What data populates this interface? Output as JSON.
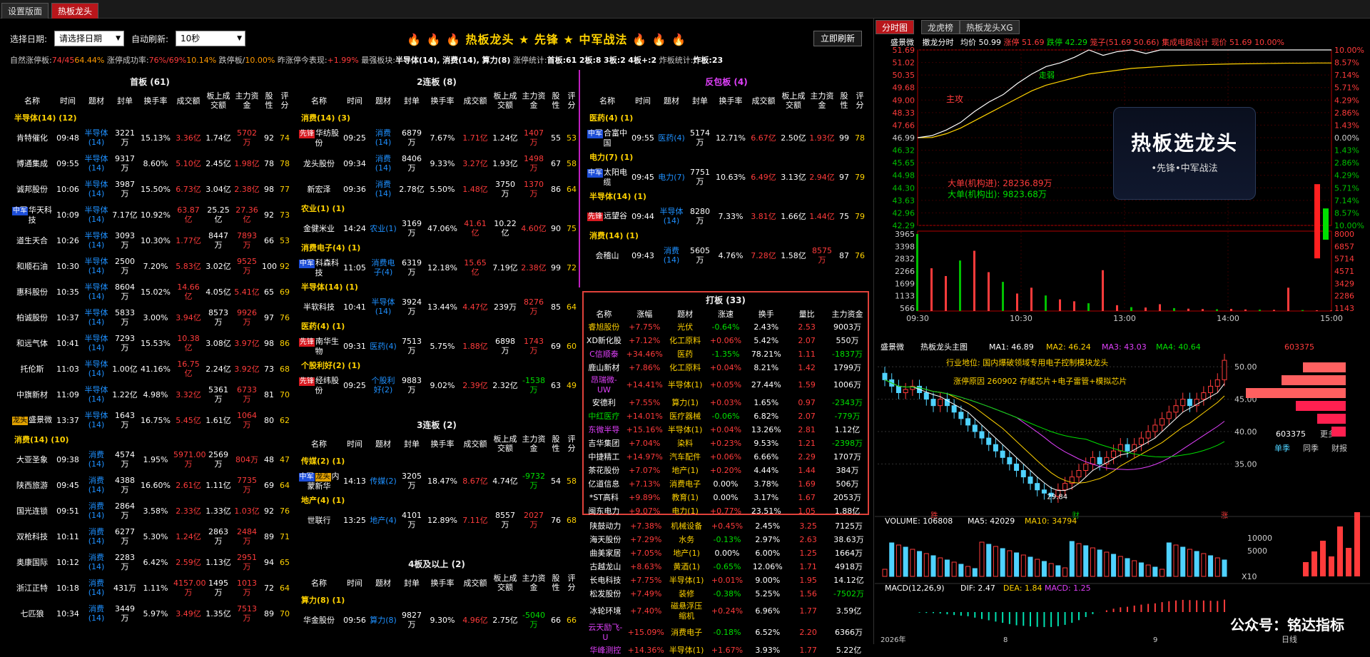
{
  "tabs": [
    "设置版面",
    "热板龙头"
  ],
  "toolbar": {
    "date_label": "选择日期:",
    "date_value": "请选择日期",
    "auto_label": "自动刷新:",
    "auto_value": "10秒",
    "title": "🔥 🔥 🔥 热板龙头 ★ 先锋 ★ 中军战法 🔥 🔥 🔥",
    "refresh": "立即刷新"
  },
  "summary": {
    "p1": "自然涨停板:",
    "v1": "74/45",
    "v1b": "64.44%",
    "p2": "涨停成功率:",
    "v2": "76%/69%",
    "v2b": "10.14%",
    "p3": "跌停板/",
    "v3": "10.00%",
    "p4": "昨涨停今表现:",
    "v4": "+1.99%",
    "p5": "最强板块:",
    "v5": "半导体(14), 消费(14), 算力(8)",
    "p6": "涨停统计:",
    "v6": "首板:61",
    "v7": "2板:8",
    "v8": "3板:2",
    "v9": "4板+:2",
    "p10": "炸板统计:",
    "v10": "炸板:23"
  },
  "col_headers": [
    "名称",
    "时间",
    "题材",
    "封单",
    "换手率",
    "成交额",
    "板上成交额",
    "主力资金",
    "股性",
    "评分"
  ],
  "p1": {
    "title": "首板 (61)",
    "groups": [
      {
        "name": "半导体(14) (12)",
        "rows": [
          [
            "",
            "肯特催化",
            "09:48",
            "半导体(14)",
            "3221万",
            "15.13%",
            "3.36亿",
            "1.74亿",
            "5702万",
            "92",
            "74"
          ],
          [
            "",
            "博通集成",
            "09:55",
            "半导体(14)",
            "9317万",
            "8.60%",
            "5.10亿",
            "2.45亿",
            "1.98亿",
            "78",
            "78"
          ],
          [
            "",
            "诚邦股份",
            "10:06",
            "半导体(14)",
            "3987万",
            "15.50%",
            "6.73亿",
            "3.04亿",
            "2.38亿",
            "98",
            "77"
          ],
          [
            "中军",
            "华天科技",
            "10:09",
            "半导体(14)",
            "7.17亿",
            "10.92%",
            "63.87亿",
            "25.25亿",
            "27.36亿",
            "92",
            "73"
          ],
          [
            "",
            "道生天合",
            "10:26",
            "半导体(14)",
            "3093万",
            "10.30%",
            "1.77亿",
            "8447万",
            "7893万",
            "66",
            "53"
          ],
          [
            "",
            "和顺石油",
            "10:30",
            "半导体(14)",
            "2500万",
            "7.20%",
            "5.83亿",
            "3.02亿",
            "9525万",
            "100",
            "92"
          ],
          [
            "",
            "惠科股份",
            "10:35",
            "半导体(14)",
            "8604万",
            "15.02%",
            "14.66亿",
            "4.05亿",
            "5.41亿",
            "65",
            "69"
          ],
          [
            "",
            "柏诚股份",
            "10:37",
            "半导体(14)",
            "5833万",
            "3.00%",
            "3.94亿",
            "8573万",
            "9926万",
            "97",
            "76"
          ],
          [
            "",
            "和远气体",
            "10:41",
            "半导体(14)",
            "7293万",
            "15.53%",
            "10.38亿",
            "3.08亿",
            "3.97亿",
            "98",
            "86"
          ],
          [
            "",
            "托伦斯",
            "11:03",
            "半导体(14)",
            "1.00亿",
            "41.16%",
            "16.75亿",
            "2.24亿",
            "3.92亿",
            "73",
            "68"
          ],
          [
            "",
            "中旗新材",
            "11:09",
            "半导体(14)",
            "1.22亿",
            "4.98%",
            "3.32亿",
            "5361万",
            "6733万",
            "81",
            "70"
          ],
          [
            "龙头",
            "盛景微",
            "13:37",
            "半导体(14)",
            "1643万",
            "16.75%",
            "5.45亿",
            "1.61亿",
            "1064万",
            "80",
            "62"
          ]
        ]
      },
      {
        "name": "消费(14) (10)",
        "rows": [
          [
            "",
            "大亚圣象",
            "09:38",
            "消费(14)",
            "4574万",
            "1.95%",
            "5971.00万",
            "2569万",
            "804万",
            "48",
            "47"
          ],
          [
            "",
            "陕西旅游",
            "09:45",
            "消费(14)",
            "4388万",
            "16.60%",
            "2.61亿",
            "1.11亿",
            "7735万",
            "69",
            "64"
          ],
          [
            "",
            "国光连锁",
            "09:51",
            "消费(14)",
            "2864万",
            "3.58%",
            "2.33亿",
            "1.33亿",
            "1.03亿",
            "92",
            "76"
          ],
          [
            "",
            "双枪科技",
            "10:11",
            "消费(14)",
            "6277万",
            "5.30%",
            "1.24亿",
            "2863万",
            "2484万",
            "89",
            "71"
          ],
          [
            "",
            "奥康国际",
            "10:12",
            "消费(14)",
            "2283万",
            "6.42%",
            "2.59亿",
            "1.13亿",
            "2951万",
            "94",
            "65"
          ],
          [
            "",
            "浙江正特",
            "10:18",
            "消费(14)",
            "431万",
            "1.11%",
            "4157.00万",
            "1495万",
            "1013万",
            "72",
            "64"
          ],
          [
            "",
            "七匹狼",
            "10:34",
            "消费(14)",
            "3449万",
            "5.97%",
            "3.49亿",
            "1.35亿",
            "7513万",
            "89",
            "70"
          ]
        ]
      }
    ]
  },
  "p2": {
    "title": "2连板 (8)",
    "groups": [
      {
        "name": "消费(14) (3)",
        "rows": [
          [
            "先锋",
            "华纺股份",
            "09:25",
            "消费(14)",
            "6879万",
            "7.67%",
            "1.71亿",
            "1.24亿",
            "1407万",
            "55",
            "53"
          ],
          [
            "",
            "龙头股份",
            "09:34",
            "消费(14)",
            "8406万",
            "9.33%",
            "3.27亿",
            "1.93亿",
            "1498万",
            "67",
            "58"
          ],
          [
            "",
            "新宏泽",
            "09:36",
            "消费(14)",
            "2.78亿",
            "5.50%",
            "1.48亿",
            "3750万",
            "1370万",
            "86",
            "64"
          ]
        ]
      },
      {
        "name": "农业(1) (1)",
        "rows": [
          [
            "",
            "金健米业",
            "14:24",
            "农业(1)",
            "3169万",
            "47.06%",
            "41.61亿",
            "10.22亿",
            "4.60亿",
            "90",
            "75"
          ]
        ]
      },
      {
        "name": "消费电子(4) (1)",
        "rows": [
          [
            "中军",
            "科森科技",
            "11:05",
            "消费电子(4)",
            "6319万",
            "12.18%",
            "15.65亿",
            "7.19亿",
            "2.38亿",
            "99",
            "72"
          ]
        ]
      },
      {
        "name": "半导体(14) (1)",
        "rows": [
          [
            "",
            "半软科技",
            "10:41",
            "半导体(14)",
            "3924万",
            "13.44%",
            "4.47亿",
            "239万",
            "8276万",
            "85",
            "64"
          ]
        ]
      },
      {
        "name": "医药(4) (1)",
        "rows": [
          [
            "先锋",
            "南华生物",
            "09:31",
            "医药(4)",
            "7513万",
            "5.75%",
            "1.88亿",
            "6898万",
            "1743万",
            "69",
            "60"
          ]
        ]
      },
      {
        "name": "个股利好(2) (1)",
        "rows": [
          [
            "先锋",
            "经纬股份",
            "09:25",
            "个股利好(2)",
            "9883万",
            "9.02%",
            "2.39亿",
            "2.32亿",
            "-1538万",
            "63",
            "49"
          ]
        ]
      }
    ]
  },
  "p3": {
    "title": "反包板 (4)",
    "groups": [
      {
        "name": "医药(4) (1)",
        "rows": [
          [
            "中军",
            "合富中国",
            "09:55",
            "医药(4)",
            "5174万",
            "12.71%",
            "6.67亿",
            "2.50亿",
            "1.93亿",
            "99",
            "78"
          ]
        ]
      },
      {
        "name": "电力(7) (1)",
        "rows": [
          [
            "中军",
            "太阳电缆",
            "09:45",
            "电力(7)",
            "7751万",
            "10.63%",
            "6.49亿",
            "3.13亿",
            "2.94亿",
            "97",
            "79"
          ]
        ]
      },
      {
        "name": "半导体(14) (1)",
        "rows": [
          [
            "先锋",
            "远望谷",
            "09:44",
            "半导体(14)",
            "8280万",
            "7.33%",
            "3.81亿",
            "1.66亿",
            "1.44亿",
            "75",
            "79"
          ]
        ]
      },
      {
        "name": "消费(14) (1)",
        "rows": [
          [
            "",
            "会稽山",
            "09:43",
            "消费(14)",
            "5605万",
            "4.76%",
            "7.28亿",
            "1.58亿",
            "8575万",
            "87",
            "76"
          ]
        ]
      }
    ]
  },
  "p4": {
    "title": "3连板 (2)",
    "groups": [
      {
        "name": "传媒(2) (1)",
        "rows": [
          [
            "中军 龙头",
            "内蒙新华",
            "14:13",
            "传媒(2)",
            "3205万",
            "18.47%",
            "8.67亿",
            "4.74亿",
            "-9732万",
            "54",
            "58"
          ]
        ]
      },
      {
        "name": "地产(4) (1)",
        "rows": [
          [
            "",
            "世联行",
            "13:25",
            "地产(4)",
            "4101万",
            "12.89%",
            "7.11亿",
            "8557万",
            "2027万",
            "76",
            "68"
          ]
        ]
      }
    ]
  },
  "p5": {
    "title": "4板及以上 (2)",
    "groups": [
      {
        "name": "算力(8) (1)",
        "rows": [
          [
            "",
            "华金股份",
            "09:56",
            "算力(8)",
            "9827万",
            "9.30%",
            "4.96亿",
            "2.75亿",
            "-5040万",
            "66",
            "66"
          ]
        ]
      }
    ]
  },
  "dab": {
    "title": "打板 (33)",
    "headers": [
      "名称",
      "涨幅",
      "题材",
      "涨速",
      "换手",
      "量比",
      "主力资金"
    ],
    "rows": [
      [
        "睿旭股份",
        "+7.75%",
        "光伏",
        "-0.64%",
        "2.43%",
        "2.53",
        "9003万"
      ],
      [
        "XD新化股",
        "+7.12%",
        "化工原料",
        "+0.06%",
        "5.42%",
        "2.07",
        "550万"
      ],
      [
        "C信顺泰",
        "+34.46%",
        "医药",
        "-1.35%",
        "78.21%",
        "1.11",
        "-1837万"
      ],
      [
        "鹿山新材",
        "+7.86%",
        "化工原料",
        "+0.04%",
        "8.21%",
        "1.42",
        "1799万"
      ],
      [
        "昂瑞微-UW",
        "+14.41%",
        "半导体(1)",
        "+0.05%",
        "27.44%",
        "1.59",
        "1006万"
      ],
      [
        "安德利",
        "+7.55%",
        "算力(1)",
        "+0.03%",
        "1.65%",
        "0.97",
        "-2343万"
      ],
      [
        "中红医疗",
        "+14.01%",
        "医疗器械",
        "-0.06%",
        "6.82%",
        "2.07",
        "-779万"
      ],
      [
        "东微半导",
        "+15.16%",
        "半导体(1)",
        "+0.04%",
        "13.26%",
        "2.81",
        "1.12亿"
      ],
      [
        "吉华集团",
        "+7.04%",
        "染料",
        "+0.23%",
        "9.53%",
        "1.21",
        "-2398万"
      ],
      [
        "中捷精工",
        "+14.97%",
        "汽车配件",
        "+0.06%",
        "6.66%",
        "2.29",
        "1707万"
      ],
      [
        "茶花股份",
        "+7.07%",
        "地产(1)",
        "+0.20%",
        "4.44%",
        "1.44",
        "384万"
      ],
      [
        "亿道信息",
        "+7.13%",
        "消费电子",
        "0.00%",
        "3.78%",
        "1.69",
        "506万"
      ],
      [
        "*ST高科",
        "+9.89%",
        "教育(1)",
        "0.00%",
        "3.17%",
        "1.67",
        "2053万"
      ],
      [
        "闽东电力",
        "+9.07%",
        "电力(1)",
        "+0.77%",
        "23.51%",
        "1.05",
        "1.88亿"
      ],
      [
        "陕鼓动力",
        "+7.38%",
        "机械设备",
        "+0.45%",
        "2.45%",
        "3.25",
        "7125万"
      ],
      [
        "海天股份",
        "+7.29%",
        "水务",
        "-0.13%",
        "2.97%",
        "2.63",
        "38.63万"
      ],
      [
        "曲美家居",
        "+7.05%",
        "地产(1)",
        "0.00%",
        "6.00%",
        "1.25",
        "1664万"
      ],
      [
        "古越龙山",
        "+8.63%",
        "黄酒(1)",
        "-0.65%",
        "12.06%",
        "1.71",
        "4918万"
      ],
      [
        "长电科技",
        "+7.75%",
        "半导体(1)",
        "+0.01%",
        "9.00%",
        "1.95",
        "14.12亿"
      ],
      [
        "松发股份",
        "+7.49%",
        "装修",
        "-0.38%",
        "5.25%",
        "1.56",
        "-7502万"
      ],
      [
        "冰轮环境",
        "+7.40%",
        "磁悬浮压缩机",
        "+0.24%",
        "6.96%",
        "1.77",
        "3.59亿"
      ],
      [
        "云天励飞-U",
        "+15.09%",
        "消费电子",
        "-0.18%",
        "6.52%",
        "2.20",
        "6366万"
      ],
      [
        "华峰测控",
        "+14.36%",
        "半导体(1)",
        "+1.67%",
        "3.93%",
        "1.77",
        "5.22亿"
      ]
    ]
  },
  "right": {
    "tabs": [
      "分时图",
      "龙虎榜",
      "热板龙头XG"
    ],
    "intraday": {
      "name": "盛景微",
      "mode": "撤龙分时",
      "avg": "均价 50.99",
      "zt": "涨停 51.69",
      "dt": "跌停 42.29",
      "bid": "笼子(51.69 50.66)",
      "sector": "集成电路设计",
      "now": "现价 51.69",
      "chg": "10.00%",
      "yl": [
        "51.69",
        "51.02",
        "50.35",
        "49.68",
        "49.00",
        "48.33",
        "47.66",
        "46.99",
        "46.32",
        "45.65",
        "44.98",
        "44.30",
        "43.63",
        "42.96",
        "42.29"
      ],
      "yr": [
        "10.00%",
        "8.57%",
        "7.14%",
        "5.71%",
        "4.29%",
        "2.86%",
        "1.43%",
        "0.00%",
        "1.43%",
        "2.86%",
        "4.29%",
        "5.71%",
        "7.14%",
        "8.57%",
        "10.00%"
      ],
      "vl": [
        "3965",
        "3398",
        "2832",
        "2266",
        "1699",
        "1133",
        "566"
      ],
      "vr": [
        "8000",
        "6857",
        "5714",
        "4571",
        "3429",
        "2286",
        "1143"
      ],
      "xt": [
        "09:30",
        "10:30",
        "13:00",
        "14:00",
        "15:00"
      ],
      "attack": "主攻",
      "trend": "走弱",
      "big_in": "大单(机构进): 28236.89万",
      "big_out": "大单(机构出): 9823.68万",
      "price": [
        46.99,
        47.1,
        47.4,
        47.8,
        48.4,
        48.9,
        49.3,
        49.9,
        50.4,
        50.8,
        51.0,
        51.3,
        51.69,
        51.4,
        51.6,
        51.69,
        51.5,
        51.69,
        51.69,
        51.69,
        51.69,
        51.69,
        51.69,
        51.69,
        51.69,
        51.69,
        51.69,
        51.69,
        51.69,
        51.69
      ],
      "avg_line": [
        46.99,
        47.0,
        47.2,
        47.5,
        47.9,
        48.3,
        48.7,
        49.1,
        49.5,
        49.8,
        50.0,
        50.2,
        50.4,
        50.5,
        50.6,
        50.7,
        50.75,
        50.8,
        50.85,
        50.88,
        50.9,
        50.92,
        50.94,
        50.95,
        50.96,
        50.97,
        50.98,
        50.98,
        50.99,
        50.99
      ],
      "vol": [
        3965,
        2200,
        1800,
        2600,
        3100,
        2000,
        1500,
        900,
        1200,
        800,
        600,
        500,
        400,
        2100,
        300,
        200,
        180,
        350,
        150,
        120,
        100,
        90,
        110,
        80,
        70,
        60,
        1200,
        50,
        40,
        30
      ]
    },
    "logo": {
      "line1": "热板选龙头",
      "line2": "•先锋•中军战法"
    },
    "kline": {
      "name": "盛景微",
      "title": "热板龙头主图",
      "ma1": "MA1: 46.89",
      "ma2": "MA2: 46.24",
      "ma3": "MA3: 43.03",
      "ma4": "MA4: 40.64",
      "code": "603375",
      "pos": "行业地位: 国内爆破领域专用电子控制模块龙头",
      "reason": "涨停原因 260902 存储芯片+电子雷管+模拟芯片",
      "low": "29.84",
      "yl": [
        "50.00",
        "45.00",
        "40.00",
        "35.00"
      ],
      "dates": [
        "2026年",
        "8",
        "9"
      ],
      "marks": [
        "跌",
        "财",
        "涨"
      ],
      "closes": [
        48,
        47,
        46,
        46.5,
        47,
        46,
        45,
        44,
        45,
        44,
        43,
        42,
        41,
        40,
        39,
        38,
        37,
        36,
        35,
        34,
        33,
        32,
        31,
        30.5,
        30,
        31,
        32,
        33,
        34,
        35,
        36,
        35,
        36,
        37,
        38,
        37,
        38,
        39,
        40,
        41,
        42,
        43,
        44,
        45,
        44,
        45,
        46,
        47,
        48,
        51
      ]
    },
    "vol": {
      "label": "VOLUME: 106808",
      "ma5": "MA5: 42029",
      "ma10": "MA10: 34794",
      "yl": [
        "10000",
        "5000"
      ],
      "x10": "X10"
    },
    "macd": {
      "label": "MACD(12,26,9)",
      "dif": "DIF: 2.47",
      "dea": "DEA: 1.84",
      "m": "MACD: 1.25"
    },
    "side": {
      "code": "603375",
      "more": "更多..",
      "tabs": [
        "单季",
        "同季",
        "财报"
      ],
      "bottom": "日线"
    }
  },
  "watermark": "公众号：铭达指标"
}
